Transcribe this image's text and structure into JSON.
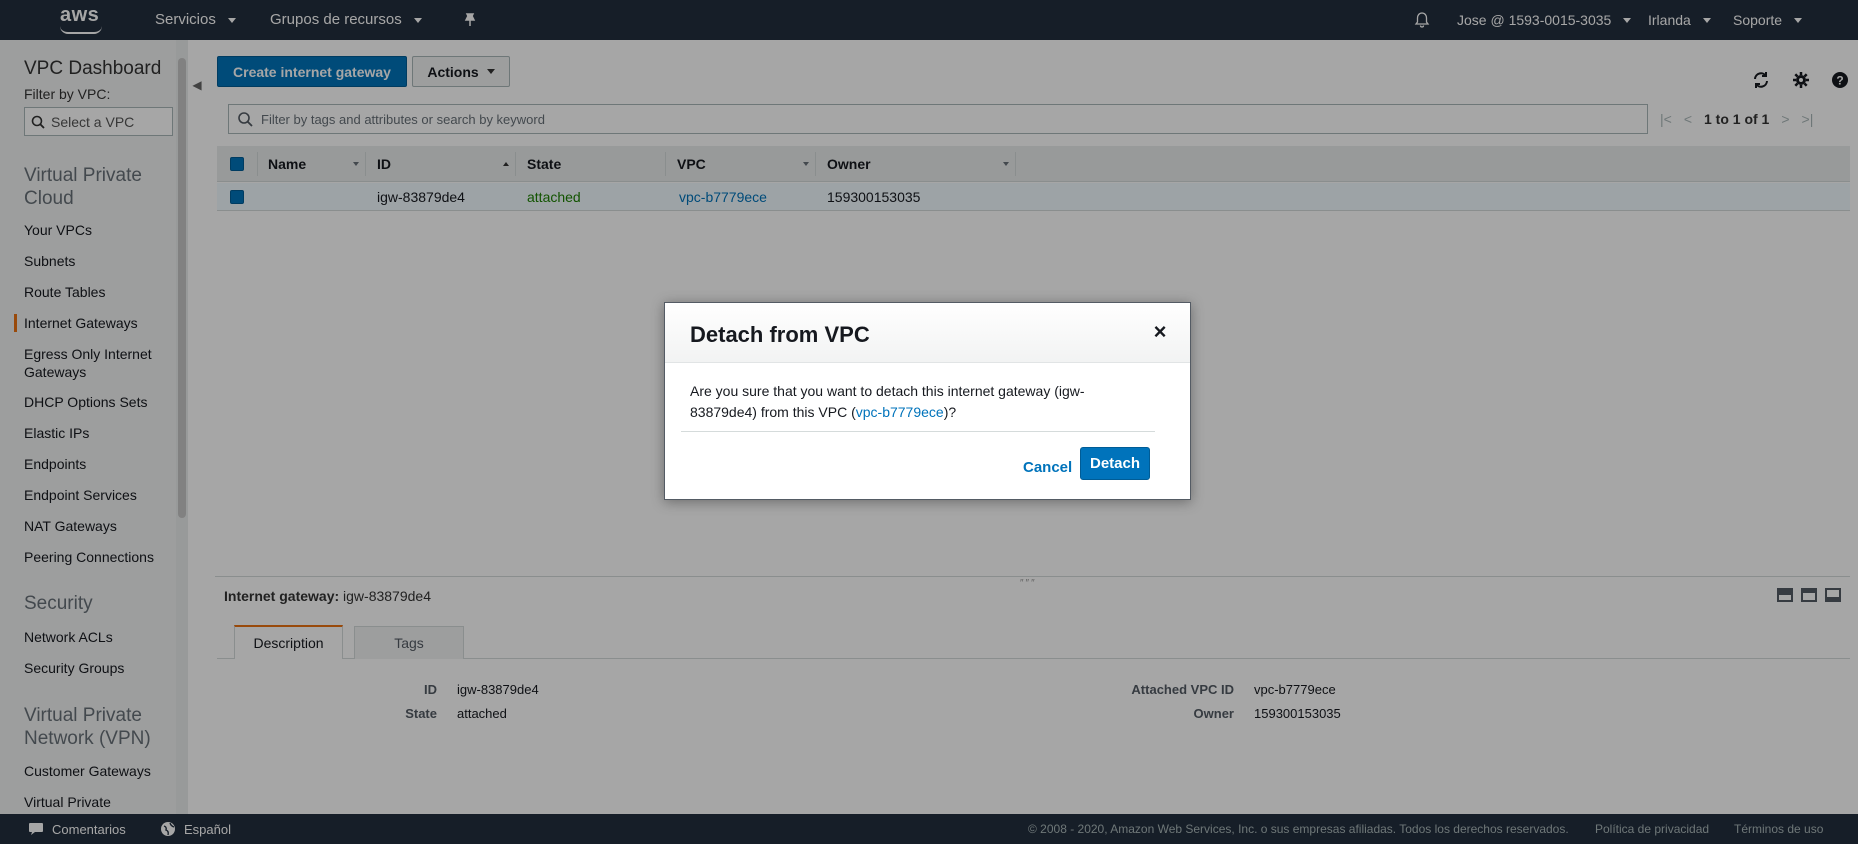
{
  "topbar": {
    "services": "Servicios",
    "resource_groups": "Grupos de recursos",
    "account": "Jose @ 1593-0015-3035",
    "region": "Irlanda",
    "support": "Soporte"
  },
  "sidebar": {
    "title": "VPC Dashboard",
    "filter_label": "Filter by VPC:",
    "select_placeholder": "Select a VPC",
    "sections": [
      {
        "title": "Virtual Private Cloud",
        "lines": [
          "Virtual Private",
          "Cloud"
        ]
      },
      {
        "title": "Security"
      },
      {
        "title": "Virtual Private Network (VPN)",
        "lines": [
          "Virtual Private",
          "Network (VPN)"
        ]
      }
    ],
    "links": [
      "Your VPCs",
      "Subnets",
      "Route Tables",
      "Internet Gateways",
      "Egress Only Internet Gateways",
      "DHCP Options Sets",
      "Elastic IPs",
      "Endpoints",
      "Endpoint Services",
      "NAT Gateways",
      "Peering Connections",
      "Network ACLs",
      "Security Groups",
      "Customer Gateways",
      "Virtual Private"
    ],
    "egress_lines": [
      "Egress Only Internet",
      "Gateways"
    ],
    "active_item": "Internet Gateways"
  },
  "toolbar": {
    "create_label": "Create internet gateway",
    "actions_label": "Actions"
  },
  "search": {
    "placeholder": "Filter by tags and attributes or search by keyword"
  },
  "pager": {
    "text": "1 to 1 of 1"
  },
  "table": {
    "columns": [
      "Name",
      "ID",
      "State",
      "VPC",
      "Owner"
    ],
    "rows": [
      {
        "name": "",
        "id": "igw-83879de4",
        "state": "attached",
        "vpc": "vpc-b7779ece",
        "owner": "159300153035"
      }
    ]
  },
  "details": {
    "label": "Internet gateway:",
    "value": "igw-83879de4",
    "tabs": [
      "Description",
      "Tags"
    ],
    "fields": {
      "id_key": "ID",
      "id_val": "igw-83879de4",
      "state_key": "State",
      "state_val": "attached",
      "vpc_key": "Attached VPC ID",
      "vpc_val": "vpc-b7779ece",
      "owner_key": "Owner",
      "owner_val": "159300153035"
    }
  },
  "modal": {
    "title": "Detach from VPC",
    "close": "×",
    "body_pre": "Are you sure that you want to detach this internet gateway (igw-83879de4) from this VPC (",
    "body_link": "vpc-b7779ece",
    "body_post": ")?",
    "cancel": "Cancel",
    "confirm": "Detach"
  },
  "footer": {
    "feedback": "Comentarios",
    "language": "Español",
    "copyright": "© 2008 - 2020, Amazon Web Services, Inc. o sus empresas afiliadas. Todos los derechos reservados.",
    "privacy": "Política de privacidad",
    "terms": "Términos de uso"
  },
  "colors": {
    "nav_bg": "#232f3e",
    "primary": "#0073bb",
    "accent": "#ec7211",
    "success": "#1d8102"
  },
  "icons": [
    "aws-logo",
    "pin-icon",
    "bell-icon",
    "search-icon",
    "refresh-icon",
    "gear-icon",
    "help-icon",
    "chat-icon",
    "globe-icon",
    "close-icon"
  ]
}
